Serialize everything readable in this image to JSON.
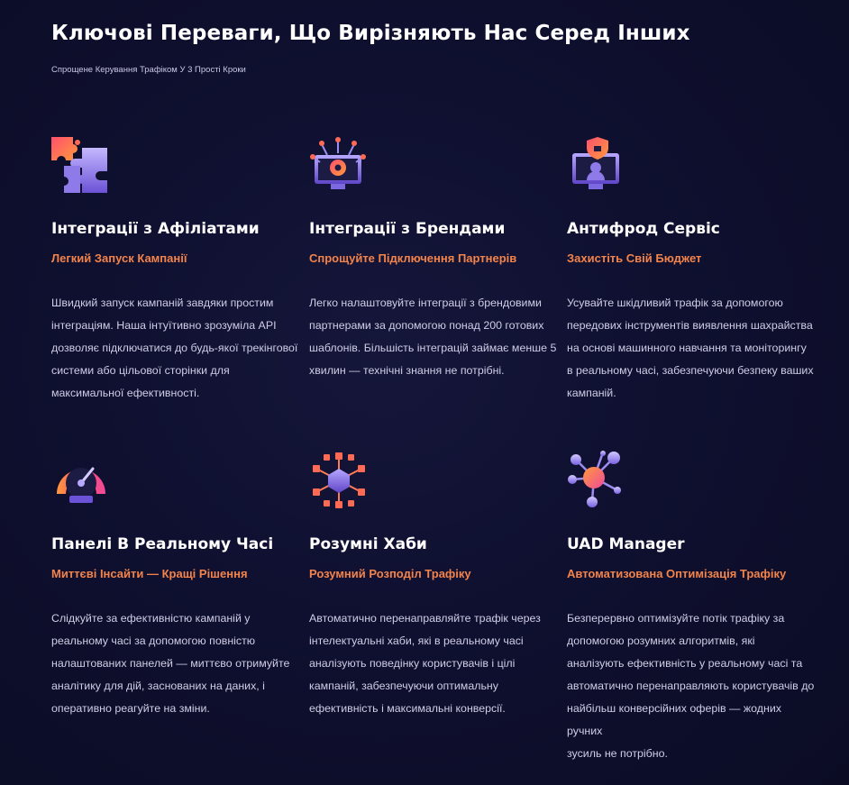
{
  "header": {
    "title": "Ключові Переваги, Що Вирізняють Нас Серед Інших",
    "subtitle": "Спрощене Керування Трафіком У 3 Прості Кроки"
  },
  "features": [
    {
      "icon": "puzzle-icon",
      "title": "Інтеграції з Афіліатами",
      "tagline": "Легкий Запуск Кампанії",
      "lines": [
        "Швидкий запуск кампаній завдяки простим",
        "інтеграціям. Наша інтуїтивно зрозуміла API",
        "дозволяє підключатися до будь-якої трекінгової",
        "системи або цільової сторінки для",
        "максимальної ефективності."
      ]
    },
    {
      "icon": "monitor-gear-icon",
      "title": "Інтеграції з Брендами",
      "tagline": "Спрощуйте Підключення Партнерів",
      "lines": [
        "Легко налаштовуйте інтеграції з брендовими",
        "партнерами за допомогою понад 200 готових",
        "шаблонів. Більшість інтеграцій займає менше 5",
        "хвилин — технічні знання не потрібні."
      ]
    },
    {
      "icon": "shield-monitor-icon",
      "title": "Антифрод Сервіс",
      "tagline": "Захистіть Свій Бюджет",
      "lines": [
        "Усувайте шкідливий трафік за допомогою",
        "передових інструментів виявлення шахрайства",
        "на основі машинного навчання та моніторингу",
        "в реальному часі, забезпечуючи безпеку ваших",
        "кампаній."
      ]
    },
    {
      "icon": "speedometer-icon",
      "title": "Панелі В Реальному Часі",
      "tagline": "Миттєві Інсайти — Кращі Рішення",
      "lines": [
        "Слідкуйте за ефективністю кампаній у",
        "реальному часі за допомогою повністю",
        "налаштованих панелей — миттєво отримуйте",
        "аналітику для дій, заснованих на даних, і",
        "оперативно реагуйте на зміни."
      ]
    },
    {
      "icon": "hub-network-icon",
      "title": "Розумні Хаби",
      "tagline": "Розумний Розподіл Трафіку",
      "lines": [
        "Автоматично перенаправляйте трафік через",
        "інтелектуальні хаби, які в реальному часі",
        "аналізують поведінку користувачів і цілі",
        "кампаній, забезпечуючи оптимальну",
        "ефективність і максимальні конверсії."
      ]
    },
    {
      "icon": "node-graph-icon",
      "title": "UAD Manager",
      "tagline": "Автоматизована Оптимізація Трафіку",
      "lines": [
        "Безперервно оптимізуйте потік трафіку за",
        "допомогою розумних алгоритмів, які",
        "аналізують ефективність у реальному часі та",
        "автоматично перенаправляють користувачів до",
        "найбільш конверсійних оферів — жодних ручних",
        "зусиль не потрібно."
      ]
    }
  ]
}
